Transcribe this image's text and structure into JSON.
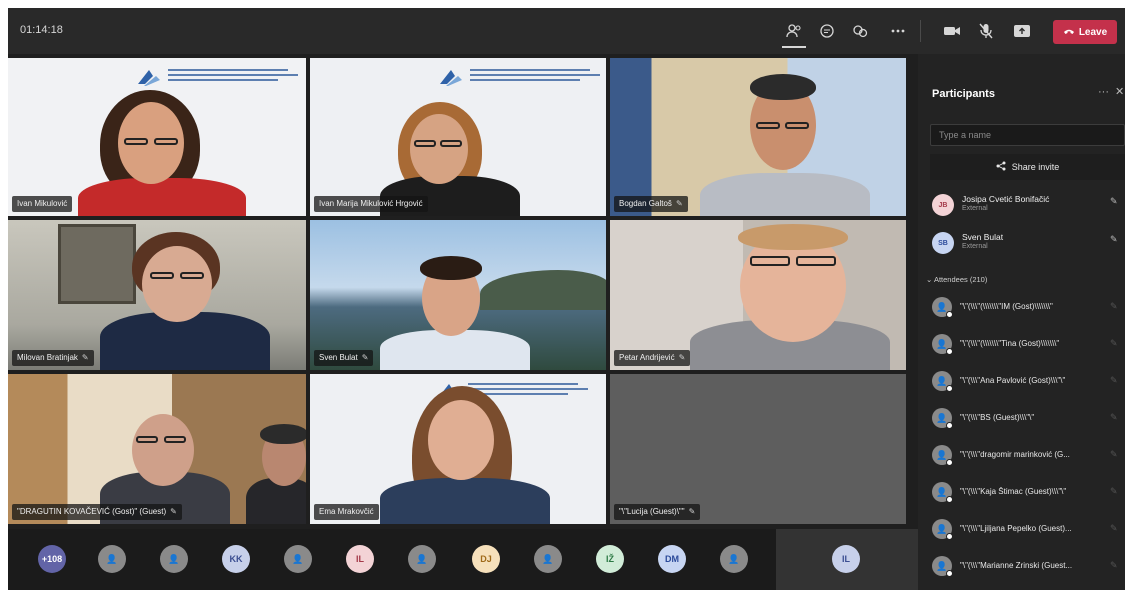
{
  "topbar": {
    "timer": "01:14:18",
    "leave_label": "Leave",
    "icons": [
      "participants-icon",
      "chat-icon",
      "reactions-icon",
      "more-icon",
      "camera-icon",
      "mic-icon",
      "share-icon"
    ]
  },
  "tiles": [
    {
      "name": "Ivan Mikulović"
    },
    {
      "name": "Ivan Marija Mikulović Hrgović"
    },
    {
      "name": "Bogdan Galtoš"
    },
    {
      "name": "Milovan Bratinjak"
    },
    {
      "name": "Sven Bulat"
    },
    {
      "name": "Petar Andrijević"
    },
    {
      "name": "\"DRAGUTIN KOVAČEVIĆ (Gost)\" (Guest)"
    },
    {
      "name": "Ema Mrakovčić"
    },
    {
      "name": "\"\\\"Lucija (Guest)\\\"\""
    }
  ],
  "bottom_strip": {
    "avatars": [
      "+108",
      "",
      "",
      "KK",
      "",
      "IL",
      "",
      "DJ",
      "",
      "IŽ",
      "DM",
      ""
    ],
    "self_initials": "IL"
  },
  "panel": {
    "title": "Participants",
    "search_placeholder": "Type a name",
    "share_invite_label": "Share invite",
    "presenters": [
      {
        "initials": "JB",
        "name": "Josipa Cvetić Bonifačić",
        "sub": "External"
      },
      {
        "initials": "SB",
        "name": "Sven Bulat",
        "sub": "External"
      }
    ],
    "attendees_header": "Attendees (210)",
    "attendees": [
      "\"\\\"(\\\\\\\"(\\\\\\\\\\\\\\\"IM (Gost)\\\\\\\\\\\\\\\"",
      "\"\\\"(\\\\\\\"(\\\\\\\\\\\\\\\"Tina (Gost)\\\\\\\\\\\\\\\"",
      "\"\\\"(\\\\\\\"Ana Pavlović (Gost)\\\\\\\"\\\"",
      "\"\\\"(\\\\\\\"BS (Guest)\\\\\\\"\\\"",
      "\"\\\"(\\\\\\\"dragomir marinković (G...",
      "\"\\\"(\\\\\\\"Kaja Štimac (Guest)\\\\\\\"\\\"",
      "\"\\\"(\\\\\\\"Ljiljana Pepelko (Guest)...",
      "\"\\\"(\\\\\\\"Marianne Zrinski (Guest..."
    ]
  },
  "colors": {
    "leave": "#c4314b",
    "panel_bg": "#232323",
    "topbar_bg": "#292929"
  }
}
